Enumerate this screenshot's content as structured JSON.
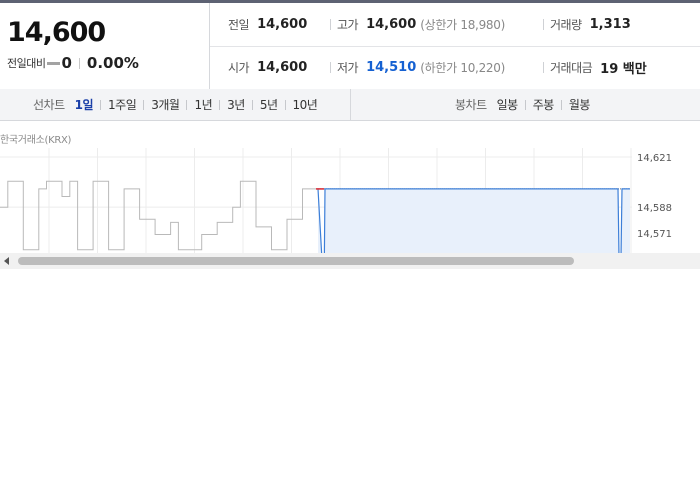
{
  "summary": {
    "current_price": "14,600",
    "change_label": "전일대비",
    "change_value": "0",
    "change_rate": "0.00%",
    "row1": {
      "prev_close": {
        "label": "전일",
        "value": "14,600"
      },
      "high": {
        "label": "고가",
        "value": "14,600",
        "limit_text": "(상한가 18,980)"
      },
      "volume": {
        "label": "거래량",
        "value": "1,313"
      }
    },
    "row2": {
      "open": {
        "label": "시가",
        "value": "14,600"
      },
      "low": {
        "label": "저가",
        "value": "14,510",
        "limit_text": "(하한가 10,220)"
      },
      "amount": {
        "label": "거래대금",
        "value": "19 백만"
      }
    }
  },
  "period_bar": {
    "line_label": "선차트",
    "line_periods": [
      "1일",
      "1주일",
      "3개월",
      "1년",
      "3년",
      "5년",
      "10년"
    ],
    "line_active": 0,
    "candle_label": "봉차트",
    "candle_periods": [
      "일봉",
      "주봉",
      "월봉"
    ]
  },
  "chart": {
    "source": "한국거래소(KRX)",
    "y_ticks": [
      "14,621",
      "14,588",
      "14,571"
    ],
    "colors": {
      "previous_line": "#b9b9b9",
      "today_line": "#3d7fd8",
      "today_fill": "#e8f0fb",
      "marker": "#d9323c",
      "grid": "#ececec"
    }
  },
  "chart_data": {
    "type": "line",
    "title": "",
    "xlabel": "",
    "ylabel": "",
    "ylim": [
      14571,
      14621
    ],
    "series": [
      {
        "values": [
          14588,
          14605,
          14605,
          14560,
          14560,
          14600,
          14605,
          14605,
          14595,
          14605,
          14560,
          14560,
          14605,
          14605,
          14560,
          14560,
          14600,
          14600,
          14580,
          14580,
          14570,
          14570,
          14578,
          14560,
          14560,
          14560,
          14570,
          14570,
          14578,
          14578,
          14588,
          14605,
          14605,
          14575,
          14575,
          14560,
          14560,
          14580,
          14580,
          14600,
          14600,
          14600
        ]
      },
      {
        "values": [
          14600,
          14530,
          14600,
          14600,
          14600,
          14600,
          14600,
          14510,
          14600,
          14600
        ]
      }
    ]
  }
}
